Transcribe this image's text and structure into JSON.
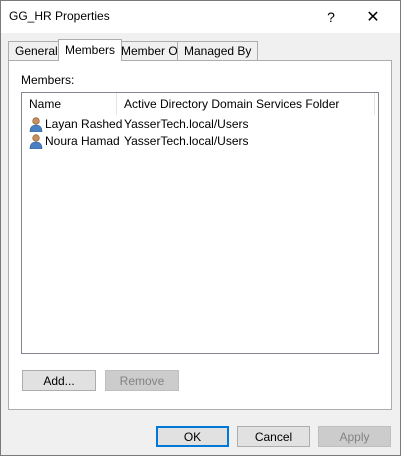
{
  "window": {
    "title": "GG_HR Properties",
    "help_glyph": "?",
    "close_glyph": "✕"
  },
  "tabs": [
    {
      "label": "General",
      "active": false
    },
    {
      "label": "Members",
      "active": true
    },
    {
      "label": "Member Of",
      "active": false
    },
    {
      "label": "Managed By",
      "active": false
    }
  ],
  "members": {
    "label": "Members:",
    "columns": {
      "name": "Name",
      "folder": "Active Directory Domain Services Folder"
    },
    "rows": [
      {
        "name": "Layan Rashed",
        "folder": "YasserTech.local/Users",
        "icon": "user-icon"
      },
      {
        "name": "Noura Hamad",
        "folder": "YasserTech.local/Users",
        "icon": "user-icon"
      }
    ],
    "add_label": "Add...",
    "remove_label": "Remove"
  },
  "footer": {
    "ok_label": "OK",
    "cancel_label": "Cancel",
    "apply_label": "Apply"
  }
}
